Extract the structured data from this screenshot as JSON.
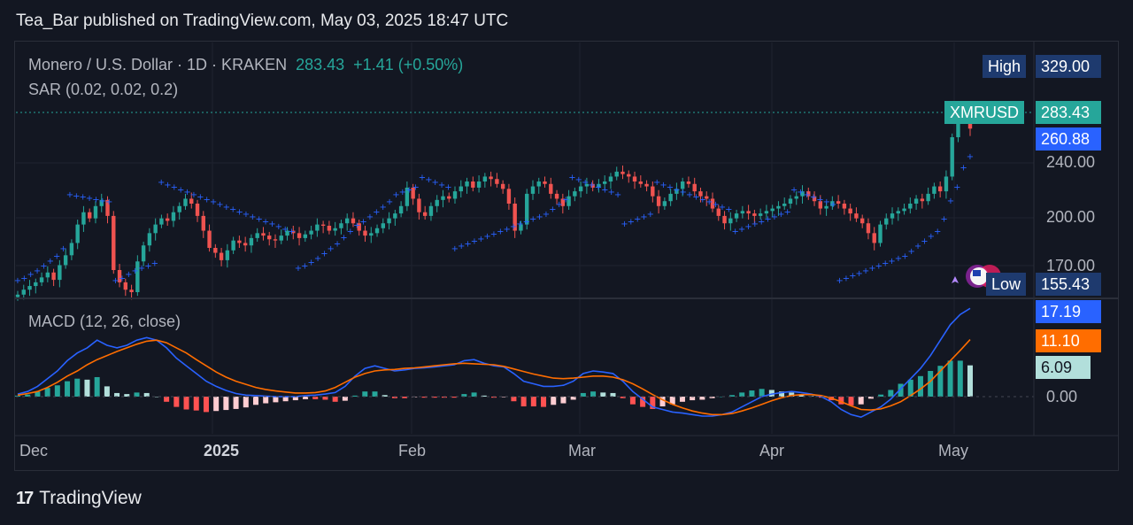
{
  "header": {
    "publish_note": "Tea_Bar published on TradingView.com, May 03, 2025 18:47 UTC"
  },
  "legend": {
    "symbol": "Monero / U.S. Dollar · 1D · KRAKEN",
    "price": "283.43",
    "change": "+1.41 (+0.50%)",
    "sar_label": "SAR (0.02, 0.02, 0.2)",
    "macd_label": "MACD (12, 26, close)"
  },
  "tags": {
    "high_label": "High",
    "high_value": "329.00",
    "ticker_label": "XMRUSD",
    "ticker_value": "283.43",
    "sar_value": "260.88",
    "low_label": "Low",
    "low_value": "155.43",
    "macd_value": "17.19",
    "signal_value": "11.10",
    "hist_value": "6.09"
  },
  "colors": {
    "bg": "#131722",
    "up": "#26a69a",
    "down": "#ef5350",
    "sar": "#2962ff",
    "macd": "#2962ff",
    "signal": "#ff6d00",
    "hist_up": "#26a69a",
    "hist_down": "#ff5252"
  },
  "footer": {
    "brand": "TradingView"
  },
  "chart_data": {
    "type": "candlestick",
    "price_axis_ticks": [
      "240.00",
      "200.00",
      "170.00"
    ],
    "macd_axis_ticks": [
      "0.00"
    ],
    "x_tick_labels": [
      "Dec",
      "2025",
      "Feb",
      "Mar",
      "Apr",
      "May"
    ],
    "price_range": [
      150,
      330
    ],
    "macd_range": [
      -8,
      20
    ],
    "candles_close": [
      148,
      152,
      155,
      158,
      162,
      166,
      160,
      172,
      180,
      190,
      205,
      215,
      210,
      220,
      225,
      212,
      168,
      158,
      152,
      150,
      175,
      188,
      198,
      205,
      210,
      208,
      215,
      220,
      226,
      222,
      212,
      200,
      186,
      182,
      176,
      184,
      192,
      190,
      188,
      194,
      198,
      196,
      193,
      192,
      196,
      200,
      198,
      194,
      197,
      200,
      205,
      204,
      200,
      202,
      206,
      210,
      206,
      200,
      196,
      198,
      202,
      206,
      210,
      214,
      220,
      235,
      226,
      215,
      212,
      220,
      225,
      228,
      226,
      232,
      236,
      240,
      235,
      240,
      244,
      242,
      238,
      234,
      222,
      200,
      205,
      230,
      236,
      240,
      238,
      230,
      226,
      220,
      228,
      232,
      236,
      238,
      235,
      238,
      240,
      244,
      248,
      246,
      244,
      240,
      238,
      236,
      228,
      220,
      224,
      230,
      234,
      240,
      238,
      232,
      228,
      226,
      218,
      212,
      206,
      210,
      214,
      216,
      214,
      212,
      214,
      216,
      218,
      220,
      222,
      226,
      228,
      232,
      228,
      224,
      218,
      220,
      224,
      222,
      218,
      214,
      210,
      206,
      198,
      190,
      205,
      210,
      214,
      216,
      218,
      222,
      226,
      224,
      230,
      236,
      232,
      244,
      276,
      295,
      292,
      283
    ],
    "sar": [
      160,
      162,
      165,
      168,
      172,
      176,
      180,
      186,
      230,
      229,
      228,
      227,
      226,
      225,
      224,
      160,
      162,
      165,
      168,
      170,
      172,
      174,
      240,
      238,
      236,
      234,
      232,
      230,
      228,
      226,
      224,
      222,
      220,
      218,
      216,
      214,
      212,
      210,
      208,
      206,
      204,
      202,
      200,
      170,
      172,
      175,
      178,
      182,
      186,
      190,
      195,
      200,
      205,
      208,
      212,
      216,
      220,
      224,
      230,
      232,
      234,
      236,
      244,
      242,
      240,
      238,
      236,
      186,
      188,
      190,
      192,
      194,
      196,
      198,
      200,
      202,
      204,
      206,
      208,
      210,
      212,
      214,
      218,
      222,
      226,
      244,
      242,
      240,
      238,
      236,
      234,
      232,
      230,
      206,
      208,
      210,
      212,
      214,
      240,
      238,
      236,
      234,
      232,
      230,
      228,
      226,
      224,
      222,
      220,
      218,
      200,
      202,
      204,
      206,
      208,
      210,
      212,
      214,
      216,
      234,
      232,
      230,
      228,
      226,
      224,
      222,
      160,
      162,
      164,
      166,
      168,
      170,
      172,
      174,
      176,
      178,
      180,
      184,
      188,
      192,
      196,
      200,
      210,
      225,
      236,
      252,
      261
    ],
    "macd": [
      0.5,
      1,
      2,
      3.5,
      5,
      7,
      8.5,
      9.5,
      11,
      10,
      9.5,
      10,
      11,
      11.5,
      11,
      9.5,
      7.5,
      6,
      4.5,
      3,
      2,
      1.2,
      0.6,
      0.3,
      0.2,
      0.1,
      0,
      0,
      0,
      0.2,
      0.3,
      0.5,
      0.8,
      2,
      4,
      5.5,
      6,
      5.5,
      5,
      5.2,
      5.5,
      5.6,
      5.8,
      6,
      6.2,
      7,
      7.2,
      6.5,
      6,
      5.8,
      4.5,
      3,
      2.5,
      2,
      2,
      2.2,
      3,
      4.5,
      5,
      4.8,
      4.5,
      3,
      1,
      -0.5,
      -2,
      -2.5,
      -3,
      -3.2,
      -3.5,
      -3.8,
      -3.8,
      -3.5,
      -3,
      -2,
      -1,
      0,
      0.5,
      0.8,
      1,
      0.8,
      0.5,
      0,
      -1,
      -2.5,
      -3.5,
      -4,
      -3,
      -2,
      -0.5,
      1.5,
      3.5,
      5.5,
      8,
      11,
      14,
      16,
      17.19
    ],
    "signal": [
      0.3,
      0.6,
      1,
      1.8,
      2.8,
      4,
      5,
      6.2,
      7.2,
      8,
      8.8,
      9.5,
      10.2,
      10.8,
      11,
      10.5,
      9.5,
      8.5,
      7.2,
      6,
      4.8,
      3.8,
      3,
      2.4,
      1.8,
      1.4,
      1.1,
      0.9,
      0.7,
      0.7,
      0.8,
      1.1,
      1.8,
      2.8,
      3.8,
      4.5,
      5,
      5.2,
      5.3,
      5.5,
      5.6,
      5.8,
      6,
      6.2,
      6.4,
      6.5,
      6.4,
      6.3,
      6.2,
      5.9,
      5.4,
      4.9,
      4.4,
      4,
      3.6,
      3.5,
      3.6,
      3.8,
      4,
      4,
      3.8,
      3.3,
      2.5,
      1.5,
      0.4,
      -0.6,
      -1.5,
      -2.2,
      -2.8,
      -3.2,
      -3.5,
      -3.5,
      -3.3,
      -2.8,
      -2.2,
      -1.5,
      -0.8,
      -0.2,
      0.2,
      0.4,
      0.4,
      0.2,
      -0.3,
      -1,
      -1.8,
      -2.5,
      -2.6,
      -2.4,
      -1.8,
      -1,
      0.2,
      1.5,
      3,
      5,
      7,
      9,
      11.1
    ],
    "hist": [
      0.2,
      0.4,
      1,
      1.7,
      2.2,
      3,
      3.5,
      3.3,
      3.8,
      2,
      0.7,
      0.5,
      0.8,
      0.7,
      0,
      -1,
      -2,
      -2.5,
      -2.7,
      -3,
      -2.8,
      -2.6,
      -2.4,
      -2.1,
      -1.6,
      -1.3,
      -1.1,
      -0.9,
      -0.7,
      -0.5,
      -0.5,
      -0.6,
      -1,
      -0.8,
      0.2,
      1,
      1,
      0.3,
      -0.3,
      -0.3,
      -0.1,
      -0.2,
      -0.2,
      -0.2,
      -0.2,
      0.5,
      0.8,
      0.2,
      -0.2,
      -0.1,
      -0.9,
      -1.9,
      -1.9,
      -2,
      -1.6,
      -1.3,
      -0.6,
      0.7,
      1,
      0.8,
      0.7,
      -0.3,
      -1.5,
      -2,
      -2.4,
      -1.9,
      -1.5,
      -1,
      -0.7,
      -0.6,
      -0.3,
      0,
      0.3,
      0.8,
      1.2,
      1.5,
      1.3,
      1,
      0.8,
      0.4,
      0.1,
      -0.2,
      -0.7,
      -1.5,
      -1.7,
      -1.5,
      -0.4,
      0.4,
      1.3,
      2.5,
      3.3,
      4,
      5,
      6,
      7,
      7,
      6.09
    ]
  }
}
